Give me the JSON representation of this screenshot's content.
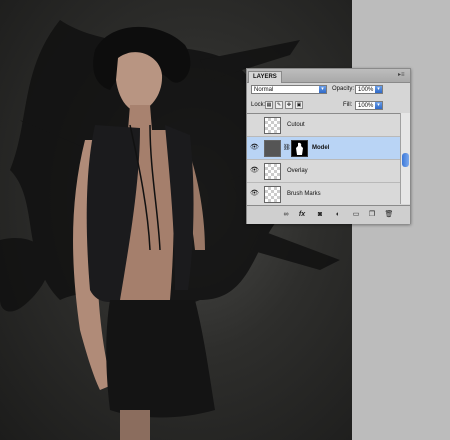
{
  "panel": {
    "tab": "LAYERS",
    "blend_mode": "Normal",
    "opacity_label": "Opacity:",
    "opacity_value": "100%",
    "lock_label": "Lock:",
    "fill_label": "Fill:",
    "fill_value": "100%"
  },
  "layers": [
    {
      "name": "Cutout",
      "visible": false,
      "selected": false
    },
    {
      "name": "Model",
      "visible": true,
      "selected": true
    },
    {
      "name": "Overlay",
      "visible": true,
      "selected": false
    },
    {
      "name": "Brush Marks",
      "visible": true,
      "selected": false
    }
  ],
  "bottom_icons": [
    "link-layers-icon",
    "fx-icon",
    "add-mask-icon",
    "adjustment-layer-icon",
    "new-group-icon",
    "new-layer-icon",
    "delete-layer-icon"
  ],
  "colors": {
    "selected_row": "#b9d4f5",
    "accent": "#3c78d8",
    "panel_bg": "#d6d6d6"
  }
}
